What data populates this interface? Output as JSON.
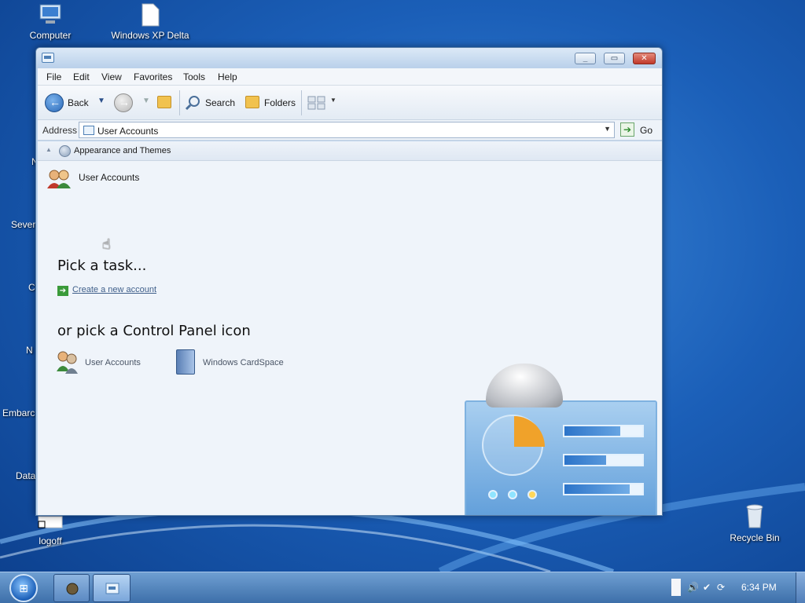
{
  "desktop": {
    "icons": [
      {
        "label": "Computer"
      },
      {
        "label": "Windows XP Delta"
      },
      {
        "label": "logoff"
      },
      {
        "label": "Recycle Bin"
      }
    ],
    "edge_labels": [
      "N",
      "Sever",
      "C",
      "N",
      "Embarc",
      "Data"
    ]
  },
  "window": {
    "menu": [
      "File",
      "Edit",
      "View",
      "Favorites",
      "Tools",
      "Help"
    ],
    "toolbar": {
      "back_label": "Back",
      "search_label": "Search",
      "folders_label": "Folders"
    },
    "address": {
      "label": "Address",
      "value": "User Accounts",
      "go_label": "Go"
    },
    "breadcrumb": "Appearance and Themes",
    "header_label": "User Accounts",
    "pick_task_heading": "Pick a task...",
    "tasks": [
      "Create a new account"
    ],
    "pick_icon_heading": "or pick a Control Panel icon",
    "cp_icons": [
      "User Accounts",
      "Windows CardSpace"
    ]
  },
  "taskbar": {
    "clock": "6:34 PM"
  },
  "colors": {
    "window_frame": "#bcd3ec",
    "content_bg": "#eff4fa",
    "link": "#3f5f8a",
    "taskbar": "#3d6fa9"
  }
}
